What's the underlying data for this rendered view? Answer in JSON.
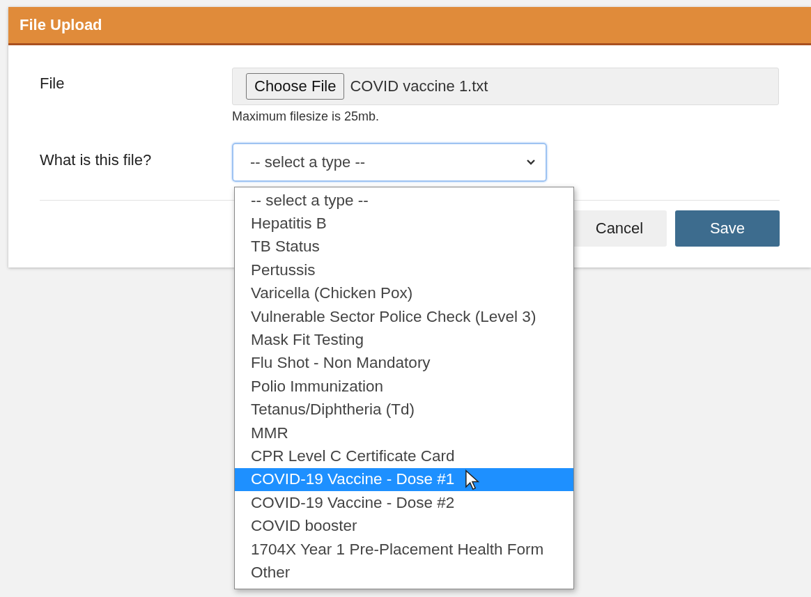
{
  "panel": {
    "title": "File Upload"
  },
  "file_field": {
    "label": "File",
    "button": "Choose File",
    "file_name": "COVID vaccine 1.txt",
    "hint": "Maximum filesize is 25mb."
  },
  "type_field": {
    "label": "What is this file?",
    "value": "-- select a type --",
    "expanded": true
  },
  "options": [
    {
      "label": "-- select a type --",
      "selected": false
    },
    {
      "label": "Hepatitis B",
      "selected": false
    },
    {
      "label": "TB Status",
      "selected": false
    },
    {
      "label": "Pertussis",
      "selected": false
    },
    {
      "label": "Varicella (Chicken Pox)",
      "selected": false
    },
    {
      "label": "Vulnerable Sector Police Check (Level 3)",
      "selected": false
    },
    {
      "label": "Mask Fit Testing",
      "selected": false
    },
    {
      "label": "Flu Shot - Non Mandatory",
      "selected": false
    },
    {
      "label": "Polio Immunization",
      "selected": false
    },
    {
      "label": "Tetanus/Diphtheria (Td)",
      "selected": false
    },
    {
      "label": "MMR",
      "selected": false
    },
    {
      "label": "CPR Level C Certificate Card",
      "selected": false
    },
    {
      "label": "COVID-19 Vaccine - Dose #1",
      "selected": true
    },
    {
      "label": "COVID-19 Vaccine - Dose #2",
      "selected": false
    },
    {
      "label": "COVID booster",
      "selected": false
    },
    {
      "label": "1704X Year 1 Pre-Placement Health Form",
      "selected": false
    },
    {
      "label": "Other",
      "selected": false
    }
  ],
  "buttons": {
    "cancel": "Cancel",
    "save": "Save"
  }
}
